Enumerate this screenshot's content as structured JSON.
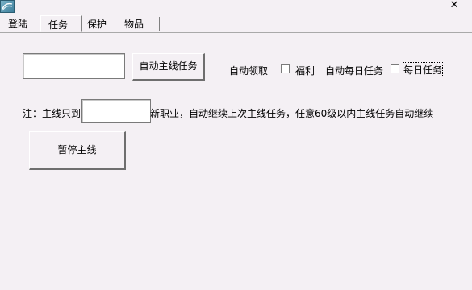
{
  "window": {
    "close_glyph": "✕"
  },
  "tabs": [
    {
      "label": "登陆"
    },
    {
      "label": "任务"
    },
    {
      "label": "保护"
    },
    {
      "label": "物品"
    },
    {
      "label": ""
    }
  ],
  "main_task": {
    "input_value": "",
    "auto_button": "自动主线任务",
    "auto_claim_label": "自动领取",
    "welfare_label": "福利",
    "daily_auto_label": "自动每日任务",
    "daily_task_label": "每日任务",
    "welfare_checked": false,
    "daily_checked": false
  },
  "note": {
    "prefix": "注：主线只到",
    "level_value": "",
    "suffix": "新职业，自动继续上次主线任务，任意60级以内主线任务自动继续"
  },
  "pause_button": "暂停主线",
  "icons": {
    "app": "app-icon",
    "close": "close-icon"
  }
}
